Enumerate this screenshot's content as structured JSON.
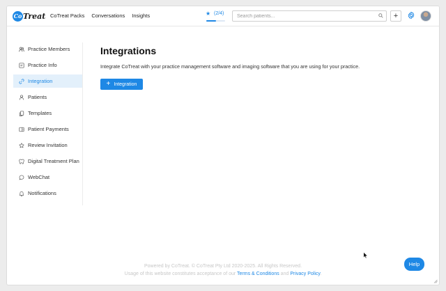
{
  "header": {
    "logo_mark": "Co",
    "logo_text": "Treat",
    "nav": [
      "CoTreat Packs",
      "Conversations",
      "Insights"
    ],
    "progress": {
      "label": "(2/4)",
      "fraction": 0.5
    },
    "search_placeholder": "Search patients...",
    "add_label": "+",
    "icons": [
      "star-icon",
      "search-icon",
      "plus-icon",
      "gear-icon",
      "avatar"
    ]
  },
  "sidebar": {
    "items": [
      {
        "label": "Practice Members",
        "icon": "users-icon",
        "active": false
      },
      {
        "label": "Practice Info",
        "icon": "info-icon",
        "active": false
      },
      {
        "label": "Integration",
        "icon": "link-icon",
        "active": true
      },
      {
        "label": "Patients",
        "icon": "user-icon",
        "active": false
      },
      {
        "label": "Templates",
        "icon": "copy-icon",
        "active": false
      },
      {
        "label": "Patient Payments",
        "icon": "card-icon",
        "active": false
      },
      {
        "label": "Review Invitation",
        "icon": "star-outline-icon",
        "active": false
      },
      {
        "label": "Digital Treatment Plan",
        "icon": "tooth-icon",
        "active": false
      },
      {
        "label": "WebChat",
        "icon": "chat-icon",
        "active": false
      },
      {
        "label": "Notifications",
        "icon": "bell-icon",
        "active": false
      }
    ]
  },
  "main": {
    "title": "Integrations",
    "description": "Integrate CoTreat with your practice management software and imaging software that you are using for your practice.",
    "button_label": "Integration"
  },
  "footer": {
    "line1": "Powered by CoTreat. © CoTreat Pty Ltd 2020-2025. All Rights Reserved.",
    "line2_prefix": "Usage of this website constitutes acceptance of our ",
    "terms": "Terms & Conditions",
    "and": " and ",
    "privacy": "Privacy Policy",
    "line2_suffix": "."
  },
  "help_label": "Help",
  "colors": {
    "accent": "#1e88e5",
    "active_bg": "#e3f0fb"
  }
}
